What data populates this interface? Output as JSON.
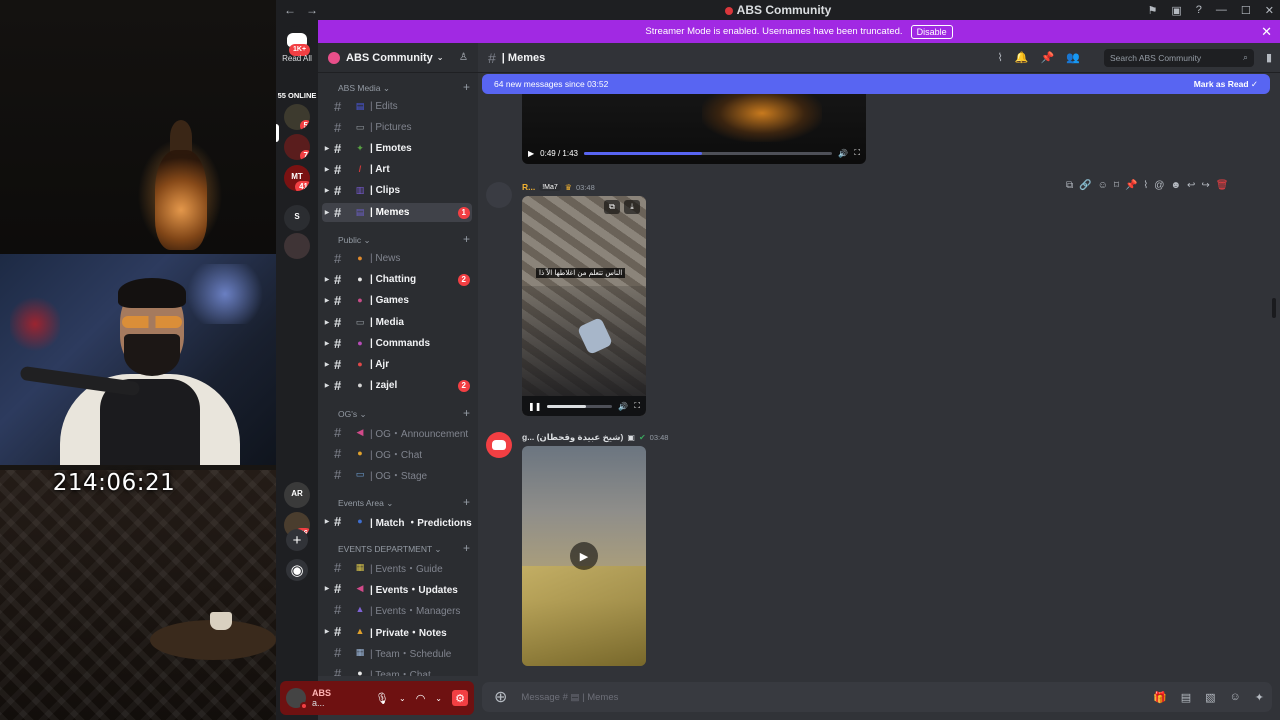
{
  "overlay": {
    "timer": "214:06:21"
  },
  "titlebar": {
    "title": "ABS Community"
  },
  "guilds": {
    "home_badge": "1K+",
    "read_all": "Read All",
    "online": "55 ONLINE",
    "servers": [
      {
        "badge": "5",
        "color": "#3d3a2e"
      },
      {
        "badge": "7",
        "color": "#5a1d1d"
      },
      {
        "badge": "41",
        "color": "#7a1212",
        "label": "MT"
      },
      {
        "badge": "",
        "color": "#2b2d31",
        "label": "S"
      },
      {
        "badge": "",
        "color": "#3f3436"
      },
      {
        "badge": "",
        "color": "#3a3a3a",
        "label": "AR"
      },
      {
        "badge": "26",
        "color": "#4a3d2e"
      }
    ]
  },
  "streamer_bar": {
    "text": "Streamer Mode is enabled. Usernames have been truncated.",
    "button": "Disable"
  },
  "server": {
    "name": "ABS Community"
  },
  "categories": [
    {
      "label": "ABS Media"
    },
    {
      "label": "Public"
    },
    {
      "label": "OG's"
    },
    {
      "label": "Events Area"
    },
    {
      "label": "EVENTS DEPARTMENT"
    }
  ],
  "channels": [
    {
      "name": "| Edits",
      "emoji": "▤",
      "emoji_color": "#4c5ae8",
      "unread": false,
      "badge": ""
    },
    {
      "name": "| Pictures",
      "emoji": "▭",
      "emoji_color": "#9aa0a6",
      "unread": false,
      "badge": ""
    },
    {
      "name": "| Emotes",
      "emoji": "✦",
      "emoji_color": "#57a042",
      "unread": true,
      "badge": ""
    },
    {
      "name": "| Art",
      "emoji": "/",
      "emoji_color": "#d23a3a",
      "unread": true,
      "badge": ""
    },
    {
      "name": "| Clips",
      "emoji": "▥",
      "emoji_color": "#7a5cd6",
      "unread": true,
      "badge": ""
    },
    {
      "name": "| Memes",
      "emoji": "▤",
      "emoji_color": "#6b5fc9",
      "unread": true,
      "badge": "1"
    },
    {
      "name": "| News",
      "emoji": "●",
      "emoji_color": "#e08a2c",
      "unread": false,
      "badge": ""
    },
    {
      "name": "| Chatting",
      "emoji": "●",
      "emoji_color": "#e7e7e7",
      "unread": true,
      "badge": "2"
    },
    {
      "name": "| Games",
      "emoji": "●",
      "emoji_color": "#c94d8a",
      "unread": true,
      "badge": ""
    },
    {
      "name": "| Media",
      "emoji": "▭",
      "emoji_color": "#9aa0a6",
      "unread": true,
      "badge": ""
    },
    {
      "name": "| Commands",
      "emoji": "●",
      "emoji_color": "#b84cb8",
      "unread": true,
      "badge": ""
    },
    {
      "name": "| Ajr",
      "emoji": "●",
      "emoji_color": "#e04848",
      "unread": true,
      "badge": ""
    },
    {
      "name": "| zajel",
      "emoji": "●",
      "emoji_color": "#d4d4d4",
      "unread": true,
      "badge": "2"
    },
    {
      "name": "| OG・Announcement",
      "emoji": "◀",
      "emoji_color": "#d24a8a",
      "unread": false,
      "badge": ""
    },
    {
      "name": "| OG・Chat",
      "emoji": "●",
      "emoji_color": "#e0a12c",
      "unread": false,
      "badge": ""
    },
    {
      "name": "| OG・Stage",
      "emoji": "▭",
      "emoji_color": "#6fa3d8",
      "unread": false,
      "badge": ""
    },
    {
      "name": "| Match ・Predictions",
      "emoji": "●",
      "emoji_color": "#3f6fd1",
      "unread": true,
      "badge": ""
    },
    {
      "name": "| Events・Guide",
      "emoji": "▦",
      "emoji_color": "#d6c24a",
      "unread": false,
      "badge": ""
    },
    {
      "name": "| Events・Updates",
      "emoji": "◀",
      "emoji_color": "#d24a8a",
      "unread": true,
      "badge": ""
    },
    {
      "name": "| Events・Managers",
      "emoji": "▲",
      "emoji_color": "#7f63d6",
      "unread": false,
      "badge": ""
    },
    {
      "name": "| Private・Notes",
      "emoji": "▲",
      "emoji_color": "#e0a12c",
      "unread": true,
      "badge": ""
    },
    {
      "name": "| Team・Schedule",
      "emoji": "▦",
      "emoji_color": "#9bb6d8",
      "unread": false,
      "badge": ""
    },
    {
      "name": "| Team・Chat",
      "emoji": "●",
      "emoji_color": "#e7e7e7",
      "unread": false,
      "badge": ""
    }
  ],
  "user": {
    "name": "ABS",
    "status": "a..."
  },
  "chat": {
    "channel": "| Memes",
    "search_placeholder": "Search ABS Community",
    "new_messages": "64 new messages since 03:52",
    "mark_as_read": "Mark as Read",
    "video1": {
      "time": "0:49 / 1:43",
      "progress": 0.476
    },
    "messages": [
      {
        "author": "R...",
        "tag": "!Ma7",
        "time": "03:48",
        "caption": "الناس تتعلم من اغلاطها الاّ ذا",
        "progress": 0.6
      },
      {
        "author": "g... (شيخ عبيدة وقحطان)",
        "time": "03:48"
      }
    ],
    "composer_placeholder": "Message # ▤ | Memes"
  }
}
